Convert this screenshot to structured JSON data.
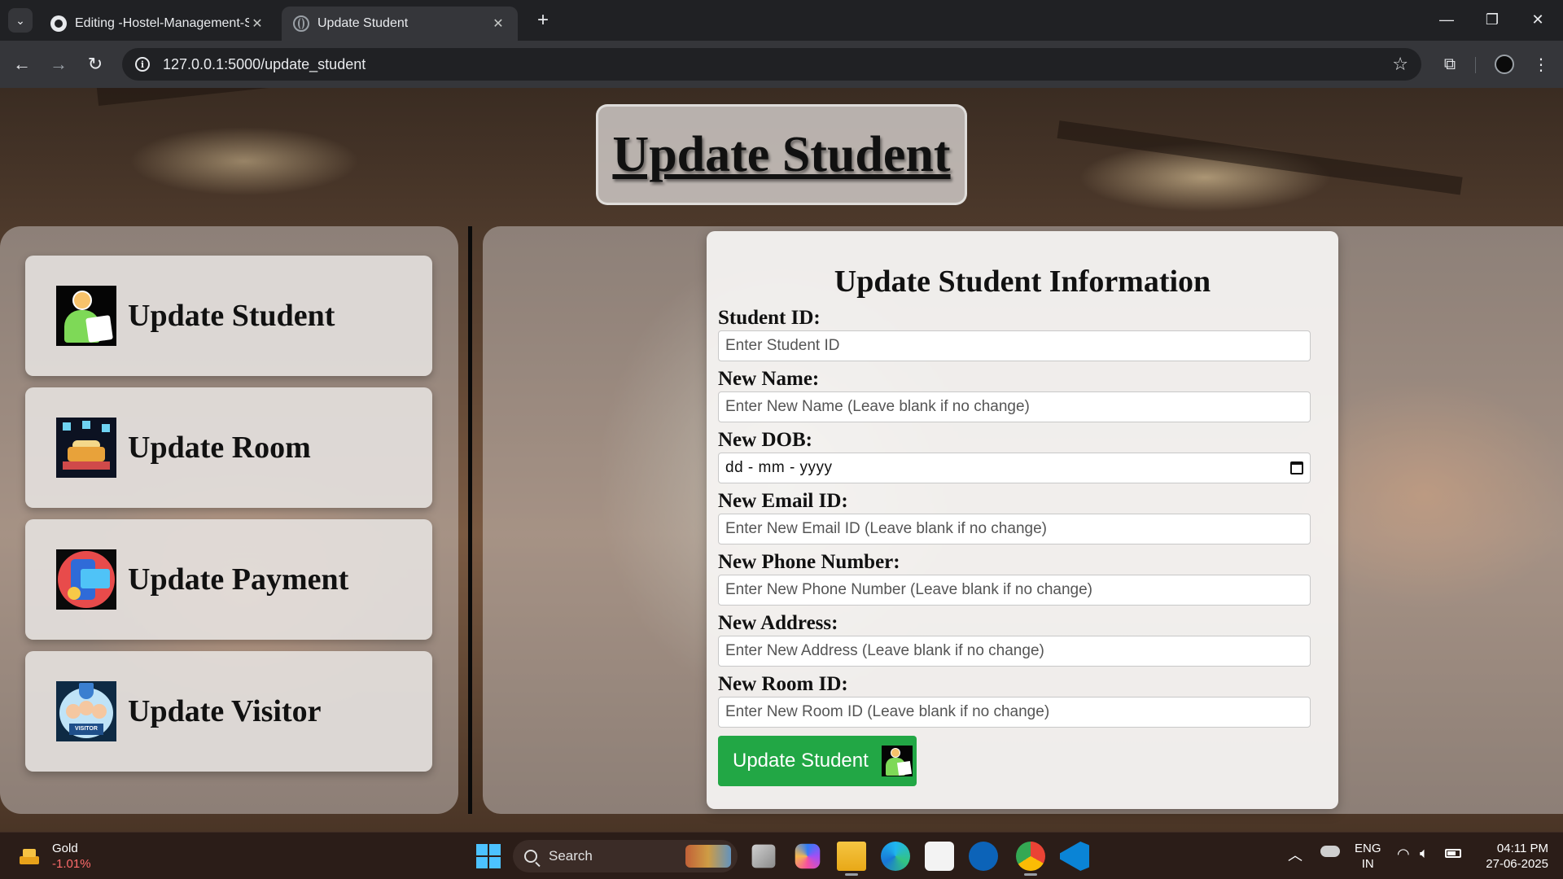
{
  "browser": {
    "tabs": [
      {
        "title": "Editing -Hostel-Management-S",
        "favicon": "github-icon",
        "active": false
      },
      {
        "title": "Update Student",
        "favicon": "globe-icon",
        "active": true
      }
    ],
    "url": "127.0.0.1:5000/update_student"
  },
  "page": {
    "title": "Update Student"
  },
  "sidebar": {
    "items": [
      {
        "label": "Update Student",
        "icon": "student-icon"
      },
      {
        "label": "Update Room",
        "icon": "room-icon"
      },
      {
        "label": "Update Payment",
        "icon": "payment-icon"
      },
      {
        "label": "Update Visitor",
        "icon": "visitor-icon"
      }
    ]
  },
  "form": {
    "heading": "Update Student Information",
    "fields": [
      {
        "label": "Student ID:",
        "placeholder": "Enter Student ID"
      },
      {
        "label": "New Name:",
        "placeholder": "Enter New Name (Leave blank if no change)"
      },
      {
        "label": "New DOB:",
        "placeholder": "dd - mm - yyyy"
      },
      {
        "label": "New Email ID:",
        "placeholder": "Enter New Email ID (Leave blank if no change)"
      },
      {
        "label": "New Phone Number:",
        "placeholder": "Enter New Phone Number (Leave blank if no change)"
      },
      {
        "label": "New Address:",
        "placeholder": "Enter New Address (Leave blank if no change)"
      },
      {
        "label": "New Room ID:",
        "placeholder": "Enter New Room ID (Leave blank if no change)"
      }
    ],
    "submit_label": "Update Student",
    "submit_color": "#22a745"
  },
  "taskbar": {
    "widget_title": "Gold",
    "widget_value": "-1.01%",
    "search_label": "Search",
    "lang_top": "ENG",
    "lang_bottom": "IN",
    "time": "04:11 PM",
    "date": "27-06-2025"
  }
}
